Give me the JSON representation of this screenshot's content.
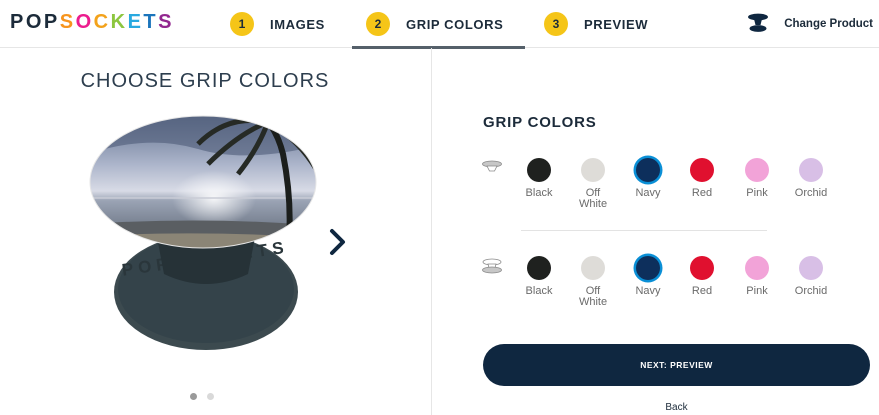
{
  "brand": {
    "letters": [
      "P",
      "O",
      "P",
      "S",
      "O",
      "C",
      "K",
      "E",
      "T",
      "S"
    ],
    "letter_colors": [
      "#1c2b3a",
      "#1c2b3a",
      "#1c2b3a",
      "#f7941d",
      "#ec1c8e",
      "#f3a21b",
      "#8dc63f",
      "#29a9e0",
      "#1b75bc",
      "#92278f"
    ]
  },
  "steps": [
    {
      "number": "1",
      "label": "IMAGES",
      "active": false
    },
    {
      "number": "2",
      "label": "GRIP COLORS",
      "active": true
    },
    {
      "number": "3",
      "label": "PREVIEW",
      "active": false
    }
  ],
  "header": {
    "change_product_label": "Change Product",
    "change_product_icon": "popsocket-product-icon"
  },
  "left": {
    "title": "CHOOSE GRIP COLORS",
    "grip_text": "POPSOCKETS",
    "next_arrow_icon": "chevron-right-icon",
    "carousel_dots": 2,
    "active_dot": 0
  },
  "right": {
    "title": "GRIP COLORS",
    "top_row_icon": "grip-top-icon",
    "bottom_row_icon": "grip-base-icon",
    "top_colors": [
      {
        "name": "Black",
        "hex": "#1f211f",
        "selected": false
      },
      {
        "name": "Off White",
        "hex": "#dedcd8",
        "selected": false
      },
      {
        "name": "Navy",
        "hex": "#0d2f5c",
        "selected": true
      },
      {
        "name": "Red",
        "hex": "#e0102f",
        "selected": false
      },
      {
        "name": "Pink",
        "hex": "#f2a3d8",
        "selected": false
      },
      {
        "name": "Orchid",
        "hex": "#d8bfe6",
        "selected": false
      }
    ],
    "bottom_colors": [
      {
        "name": "Black",
        "hex": "#1f211f",
        "selected": false
      },
      {
        "name": "Off White",
        "hex": "#dedcd8",
        "selected": false
      },
      {
        "name": "Navy",
        "hex": "#0d2f5c",
        "selected": true
      },
      {
        "name": "Red",
        "hex": "#e0102f",
        "selected": false
      },
      {
        "name": "Pink",
        "hex": "#f2a3d8",
        "selected": false
      },
      {
        "name": "Orchid",
        "hex": "#d8bfe6",
        "selected": false
      }
    ],
    "next_button_label": "NEXT: PREVIEW",
    "back_label": "Back"
  },
  "colors": {
    "accent_yellow": "#f5c518",
    "navy_button": "#0f2740",
    "selection_ring": "#0a8fd6",
    "text_dark": "#1c2b3a"
  }
}
